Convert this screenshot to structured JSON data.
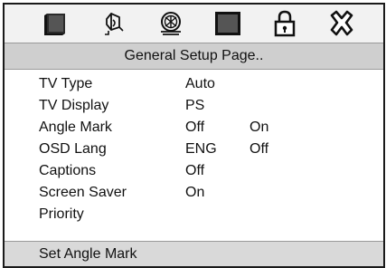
{
  "icons": [
    {
      "name": "tv-monitor-icon"
    },
    {
      "name": "speaker-audio-icon"
    },
    {
      "name": "video-reel-icon"
    },
    {
      "name": "preference-square-icon"
    },
    {
      "name": "password-lock-icon"
    },
    {
      "name": "exit-x-icon"
    }
  ],
  "header": {
    "title": "General Setup Page.."
  },
  "settings": [
    {
      "label": "TV Type",
      "value": "Auto",
      "option": ""
    },
    {
      "label": "TV Display",
      "value": "PS",
      "option": ""
    },
    {
      "label": "Angle Mark",
      "value": "Off",
      "option": "On"
    },
    {
      "label": "OSD Lang",
      "value": "ENG",
      "option": "Off"
    },
    {
      "label": "Captions",
      "value": "Off",
      "option": ""
    },
    {
      "label": "Screen Saver",
      "value": "On",
      "option": ""
    },
    {
      "label": "Priority",
      "value": "",
      "option": ""
    }
  ],
  "status": {
    "text": "Set Angle Mark"
  }
}
